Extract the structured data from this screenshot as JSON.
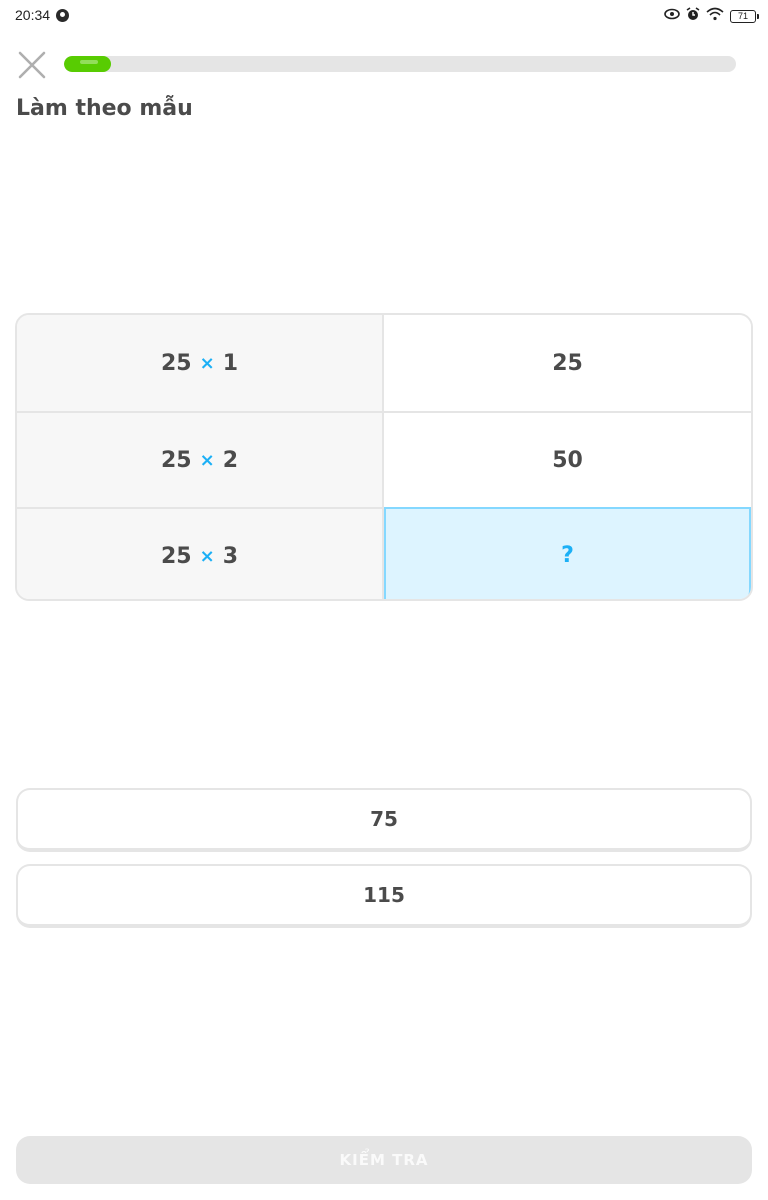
{
  "status_bar": {
    "time": "20:34",
    "battery": "71"
  },
  "lesson": {
    "progress_fraction": 0.07,
    "prompt": "Làm theo mẫu"
  },
  "pattern_table": {
    "operator": "×",
    "rows": [
      {
        "a": "25",
        "b": "1",
        "result": "25"
      },
      {
        "a": "25",
        "b": "2",
        "result": "50"
      },
      {
        "a": "25",
        "b": "3",
        "result": "?"
      }
    ]
  },
  "choices": [
    "75",
    "115"
  ],
  "check_button": {
    "label": "KIỂM TRA"
  },
  "colors": {
    "progress": "#58cc02",
    "accent_blue": "#1cb0f6",
    "answer_slot_bg": "#ddf4ff",
    "border": "#e5e5e5"
  }
}
